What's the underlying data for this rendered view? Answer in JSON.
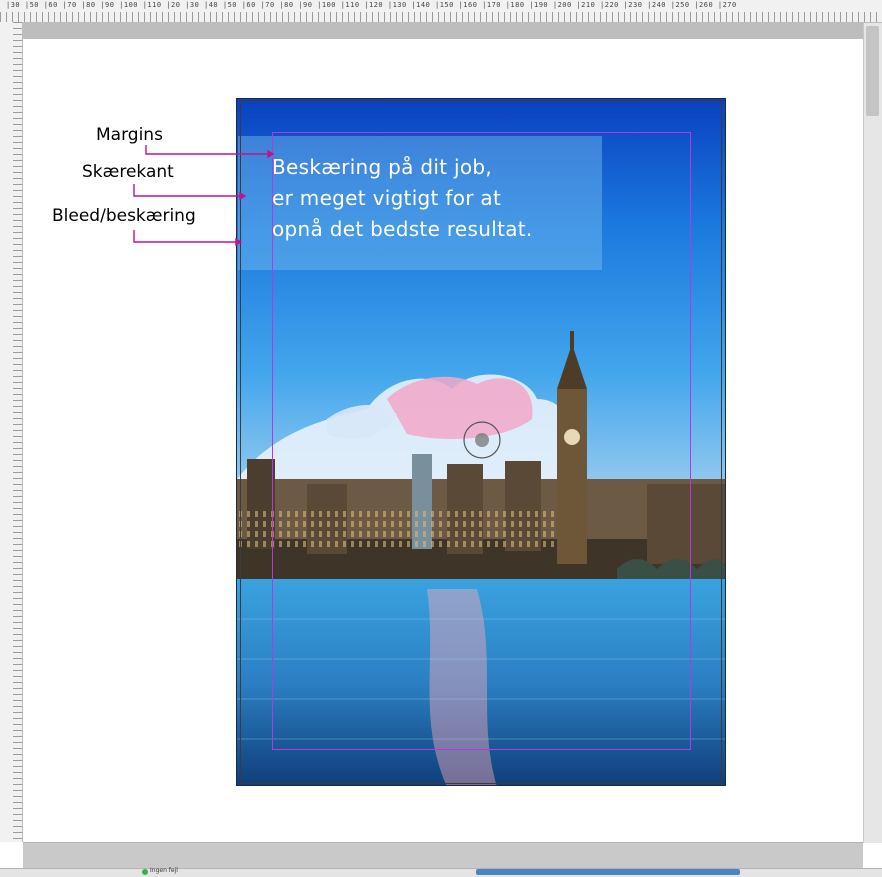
{
  "rulers": {
    "top_numbers": "|30 |50 |60 |70 |80 |90 |100 |110 |20 |30 |40 |50 |60 |70 |80 |90 |100 |110 |120 |130 |140 |150 |160 |170 |180 |190 |200 |210 |220 |230 |240 |250 |260 |270"
  },
  "callouts": {
    "margins": "Margins",
    "skaerekant": "Skærekant",
    "bleed": "Bleed/beskæring"
  },
  "poster": {
    "headline_lines": [
      "Beskæring på dit job,",
      "er meget vigtigt for at",
      "opnå det bedste resultat."
    ]
  },
  "status": {
    "text": "Ingen fejl"
  },
  "colors": {
    "guide_margin": "#b23adf",
    "leader": "#c0148a",
    "status_ok": "#2fb34a",
    "scroll_thumb": "#4a85c2"
  },
  "icons": {
    "status": "green-dot-icon",
    "target": "crosshair-icon"
  }
}
